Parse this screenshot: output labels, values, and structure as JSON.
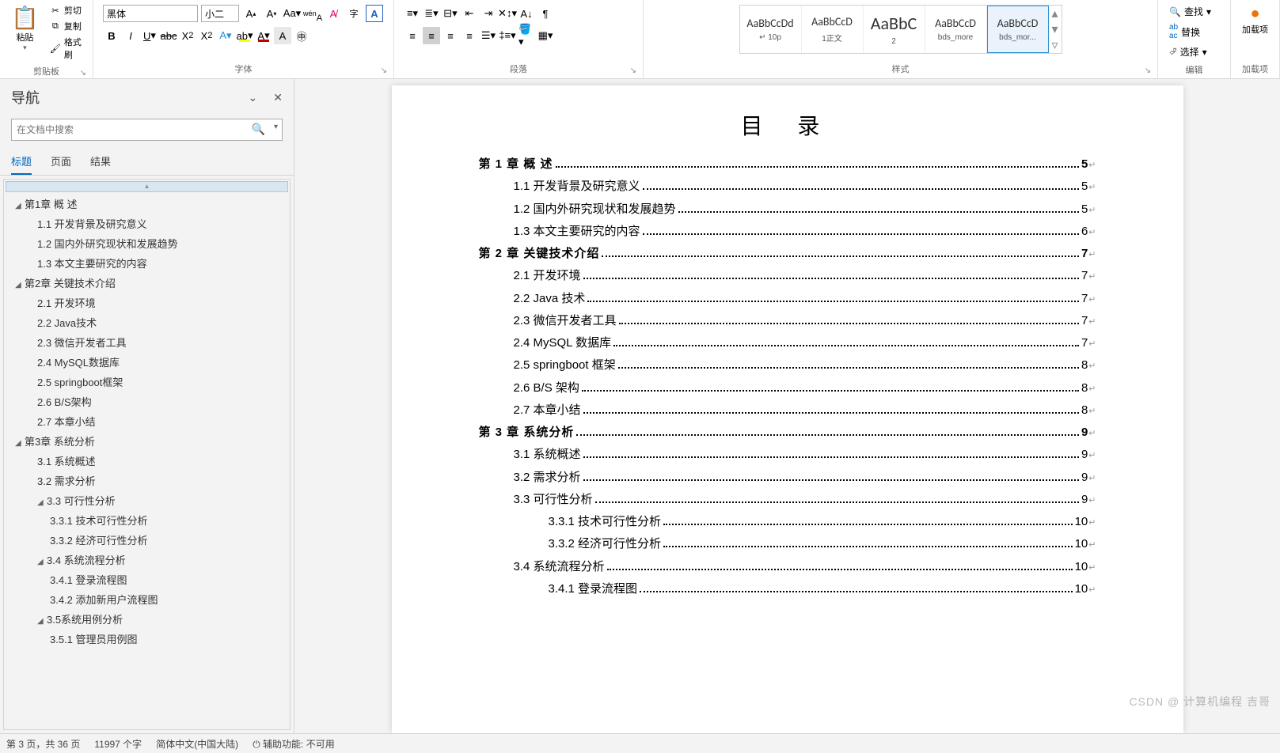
{
  "ribbon": {
    "clipboard": {
      "paste": "粘贴",
      "cut": "剪切",
      "copy": "复制",
      "painter": "格式刷",
      "label": "剪贴板"
    },
    "font": {
      "name": "黑体",
      "size": "小二",
      "label": "字体"
    },
    "paragraph": {
      "label": "段落"
    },
    "styles": {
      "label": "样式",
      "items": [
        {
          "preview": "AaBbCcDd",
          "name": "↵ 10p",
          "big": false
        },
        {
          "preview": "AaBbCcD",
          "name": "1正文",
          "big": false
        },
        {
          "preview": "AaBbC",
          "name": "2",
          "big": true
        },
        {
          "preview": "AaBbCcD",
          "name": "bds_more",
          "big": false
        },
        {
          "preview": "AaBbCcD",
          "name": "bds_mor...",
          "big": false
        }
      ]
    },
    "editing": {
      "find": "查找",
      "replace": "替换",
      "select": "选择",
      "label": "编辑"
    },
    "addins": {
      "btn": "加载项",
      "label": "加载项"
    }
  },
  "nav": {
    "title": "导航",
    "search_placeholder": "在文档中搜索",
    "tabs": [
      "标题",
      "页面",
      "结果"
    ],
    "tree": [
      {
        "l": 1,
        "arrow": "◢",
        "text": "第1章 概 述"
      },
      {
        "l": 2,
        "text": "1.1 开发背景及研究意义"
      },
      {
        "l": 2,
        "text": "1.2 国内外研究现状和发展趋势"
      },
      {
        "l": 2,
        "text": "1.3 本文主要研究的内容"
      },
      {
        "l": 1,
        "arrow": "◢",
        "text": "第2章 关键技术介绍"
      },
      {
        "l": 2,
        "text": "2.1 开发环境"
      },
      {
        "l": 2,
        "text": "2.2 Java技术"
      },
      {
        "l": 2,
        "text": "2.3 微信开发者工具"
      },
      {
        "l": 2,
        "text": "2.4 MySQL数据库"
      },
      {
        "l": 2,
        "text": "2.5 springboot框架"
      },
      {
        "l": 2,
        "text": "2.6 B/S架构"
      },
      {
        "l": 2,
        "text": "2.7 本章小结"
      },
      {
        "l": 1,
        "arrow": "◢",
        "text": "第3章 系统分析"
      },
      {
        "l": 2,
        "text": "3.1 系统概述"
      },
      {
        "l": 2,
        "text": "3.2 需求分析"
      },
      {
        "l": 3,
        "arrow": "◢",
        "text": "3.3 可行性分析"
      },
      {
        "l": 4,
        "text": "3.3.1 技术可行性分析"
      },
      {
        "l": 4,
        "text": "3.3.2 经济可行性分析"
      },
      {
        "l": 3,
        "arrow": "◢",
        "text": "3.4 系统流程分析"
      },
      {
        "l": 4,
        "text": "3.4.1 登录流程图"
      },
      {
        "l": 4,
        "text": "3.4.2 添加新用户流程图"
      },
      {
        "l": 3,
        "arrow": "◢",
        "text": "3.5系统用例分析"
      },
      {
        "l": 4,
        "text": "3.5.1 管理员用例图"
      }
    ]
  },
  "doc": {
    "title": "目  录",
    "toc": [
      {
        "level": 1,
        "label": "第 1 章  概  述",
        "page": "5"
      },
      {
        "level": 2,
        "label": "1.1  开发背景及研究意义",
        "page": "5"
      },
      {
        "level": 2,
        "label": "1.2  国内外研究现状和发展趋势",
        "page": "5"
      },
      {
        "level": 2,
        "label": "1.3  本文主要研究的内容",
        "page": "6"
      },
      {
        "level": 1,
        "label": "第 2 章  关键技术介绍",
        "page": "7"
      },
      {
        "level": 2,
        "label": "2.1  开发环境",
        "page": "7"
      },
      {
        "level": 2,
        "label": "2.2 Java 技术",
        "page": "7"
      },
      {
        "level": 2,
        "label": "2.3 微信开发者工具",
        "page": "7"
      },
      {
        "level": 2,
        "label": "2.4 MySQL 数据库",
        "page": "7"
      },
      {
        "level": 2,
        "label": "2.5 springboot 框架",
        "page": "8"
      },
      {
        "level": 2,
        "label": "2.6 B/S 架构",
        "page": "8"
      },
      {
        "level": 2,
        "label": "2.7  本章小结",
        "page": "8"
      },
      {
        "level": 1,
        "label": "第 3 章  系统分析",
        "page": "9"
      },
      {
        "level": 2,
        "label": "3.1  系统概述",
        "page": "9"
      },
      {
        "level": 2,
        "label": "3.2  需求分析",
        "page": "9"
      },
      {
        "level": 2,
        "label": "3.3  可行性分析",
        "page": "9"
      },
      {
        "level": 3,
        "label": "3.3.1  技术可行性分析",
        "page": "10"
      },
      {
        "level": 3,
        "label": "3.3.2  经济可行性分析",
        "page": "10"
      },
      {
        "level": 2,
        "label": "3.4  系统流程分析",
        "page": "10"
      },
      {
        "level": 3,
        "label": "3.4.1  登录流程图",
        "page": "10"
      }
    ]
  },
  "status": {
    "page": "第 3 页，共 36 页",
    "words": "11997 个字",
    "lang": "简体中文(中国大陆)",
    "a11y": "辅助功能: 不可用"
  },
  "watermark": "CSDN @ 计算机编程 吉哥"
}
